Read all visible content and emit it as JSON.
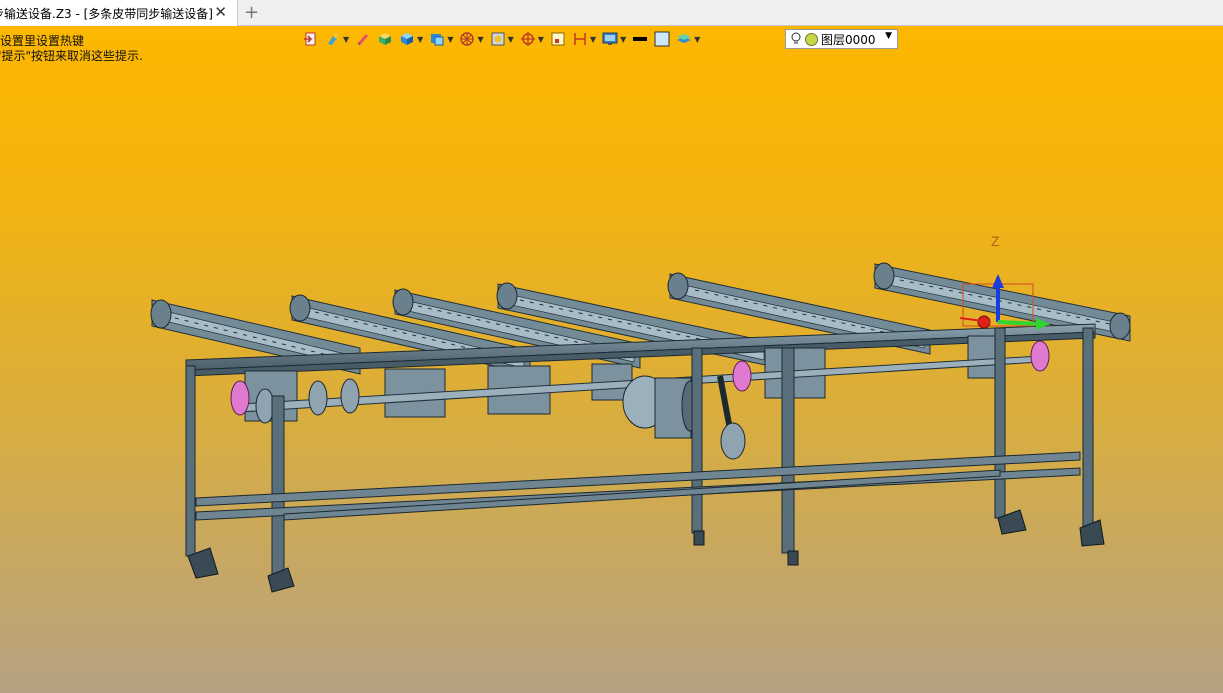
{
  "tab": {
    "title": "步输送设备.Z3 - [多条皮带同步输送设备]",
    "close_symbol": "✕",
    "add_symbol": "+"
  },
  "hints": {
    "line1": "¦设置里设置热键",
    "line2": "\"提示\"按钮来取消这些提示."
  },
  "toolbar": {
    "icons": [
      "exit-icon",
      "brush-icon",
      "eraser-icon",
      "box-icon",
      "cube-icon",
      "view-cube-icon",
      "wheel-icon",
      "render-icon",
      "snap-icon",
      "frame-icon",
      "dimension-icon",
      "display-icon",
      "line-color-icon",
      "fill-color-icon",
      "layer-stack-icon"
    ]
  },
  "layer": {
    "name": "图层0000",
    "color": "#c8d64a"
  },
  "triad": {
    "z_label": "Z",
    "x_color": "#e0201a",
    "y_color": "#2fd42f",
    "z_color": "#1a3de0"
  },
  "colors": {
    "bg_top": "#fdb700",
    "bg_bottom": "#b6a283",
    "frame": "#5a6f7c",
    "frame_dark": "#2c3a44",
    "motor_pink": "#e07ad0"
  }
}
